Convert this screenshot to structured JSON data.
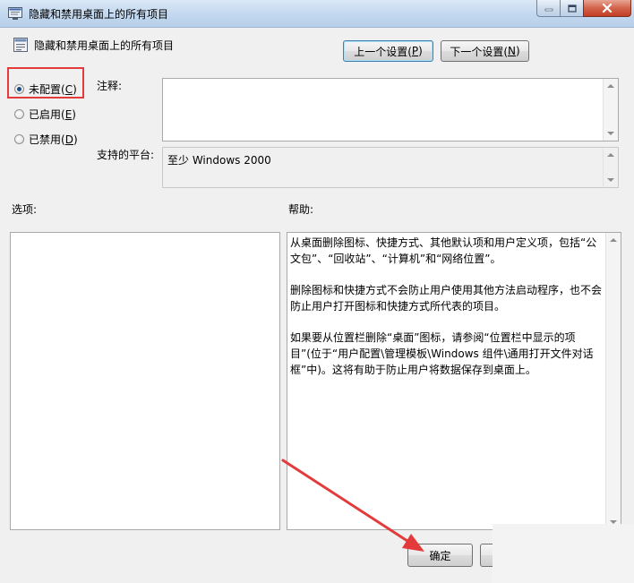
{
  "window": {
    "title": "隐藏和禁用桌面上的所有项目"
  },
  "header": {
    "policy_title": "隐藏和禁用桌面上的所有项目",
    "prev_button": {
      "text": "上一个设置(",
      "key": "P",
      "suffix": ")"
    },
    "next_button": {
      "text": "下一个设置(",
      "key": "N",
      "suffix": ")"
    }
  },
  "radios": [
    {
      "text": "未配置(",
      "key": "C",
      "suffix": ")",
      "checked": true
    },
    {
      "text": "已启用(",
      "key": "E",
      "suffix": ")",
      "checked": false
    },
    {
      "text": "已禁用(",
      "key": "D",
      "suffix": ")",
      "checked": false
    }
  ],
  "labels": {
    "comment": "注释:",
    "platform": "支持的平台:",
    "options": "选项:",
    "help": "帮助:"
  },
  "platform_value": "至少 Windows 2000",
  "help_paragraphs": [
    "从桌面删除图标、快捷方式、其他默认项和用户定义项，包括“公文包”、“回收站”、“计算机”和“网络位置”。",
    "删除图标和快捷方式不会防止用户使用其他方法启动程序，也不会防止用户打开图标和快捷方式所代表的项目。",
    "如果要从位置栏删除“桌面”图标，请参阅“位置栏中显示的项目”(位于“用户配置\\管理模板\\Windows 组件\\通用打开文件对话框”中)。这将有助于防止用户将数据保存到桌面上。"
  ],
  "footer": {
    "ok_button": "确定"
  },
  "colors": {
    "annotation_red": "#e33b3b",
    "titlebar": "#c4d9ef",
    "close_button": "#c94a30"
  },
  "icons": {
    "title": "policy-window-icon",
    "policy": "policy-setting-icon",
    "minimize": "minimize-icon",
    "maximize": "maximize-icon",
    "close": "close-icon"
  }
}
